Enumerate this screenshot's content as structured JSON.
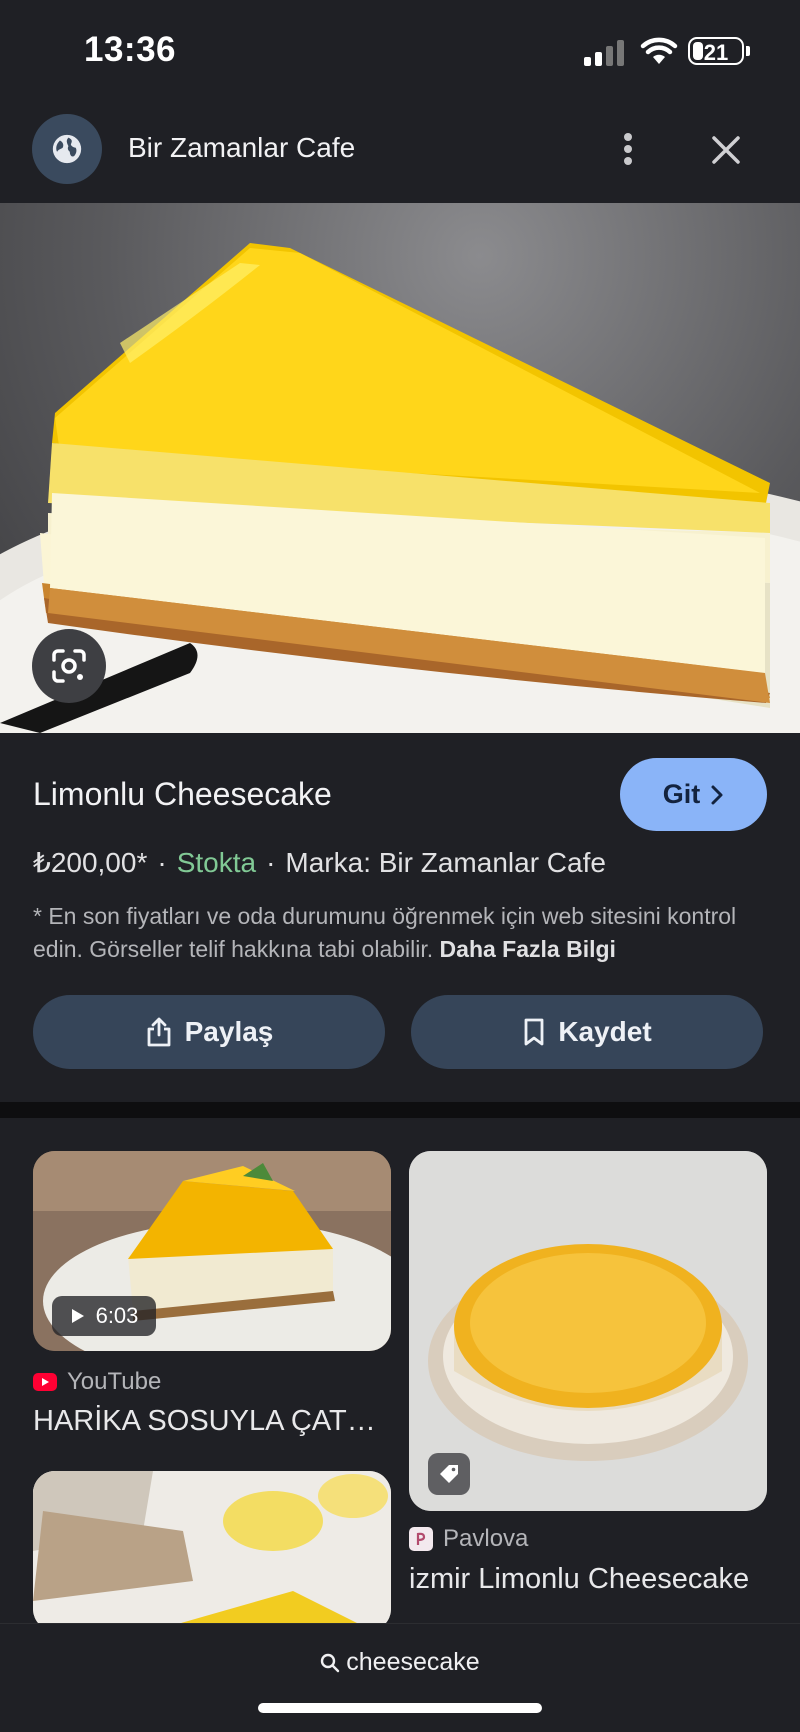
{
  "status_bar": {
    "time": "13:36",
    "battery": "21",
    "battery_level": 0.21
  },
  "header": {
    "site_name": "Bir Zamanlar Cafe",
    "icons": [
      "globe-icon",
      "more-vert-icon",
      "close-icon"
    ]
  },
  "product": {
    "name": "Limonlu Cheesecake",
    "go_label": "Git",
    "price": "₺200,00*",
    "separator": "·",
    "availability": "Stokta",
    "brand": "Marka: Bir Zamanlar Cafe",
    "disclaimer": "* En son fiyatları ve oda durumunu öğrenmek için web sitesini kontrol edin. Görseller telif hakkına tabi olabilir.",
    "more_info": "Daha Fazla Bilgi",
    "share_label": "Paylaş",
    "save_label": "Kaydet"
  },
  "results": [
    {
      "source": "YouTube",
      "title": "HARİKA SOSUYLA ÇATLAMAYAN LİMONLU CHEESECAKE",
      "duration": "6:03"
    },
    {
      "source": "Pavlova",
      "title": "izmir Limonlu Cheesecake"
    },
    {
      "source": "",
      "title": ""
    }
  ],
  "bottom": {
    "query": "cheesecake"
  },
  "colors": {
    "accent": "#8ab4f8",
    "stock": "#81c995",
    "background": "#1f2025",
    "button": "#364559"
  }
}
